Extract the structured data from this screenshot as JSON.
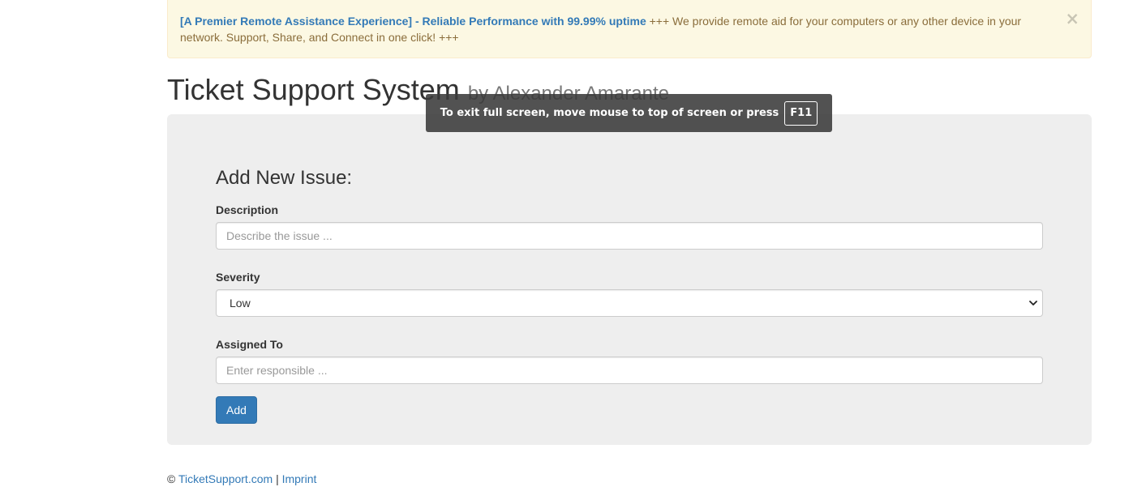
{
  "alert": {
    "link_text": "[A Premier Remote Assistance Experience] - Reliable Performance with 99.99% uptime",
    "message": " +++ We provide remote aid for your computers or any other device in your network. Support, Share, and Connect in one click! +++",
    "close_symbol": "×"
  },
  "header": {
    "title": "Ticket Support System",
    "subtitle": "by Alexander Amarante"
  },
  "form": {
    "title": "Add New Issue:",
    "description": {
      "label": "Description",
      "placeholder": "Describe the issue ..."
    },
    "severity": {
      "label": "Severity",
      "selected": "Low"
    },
    "assigned_to": {
      "label": "Assigned To",
      "placeholder": "Enter responsible ..."
    },
    "add_label": "Add"
  },
  "footer": {
    "copyright_symbol": "©",
    "site_link": "TicketSupport.com",
    "separator": "|",
    "imprint_link": "Imprint"
  },
  "fullscreen_toast": {
    "message": "To exit full screen, move mouse to top of screen or press",
    "key": "F11"
  },
  "colors": {
    "primary": "#337ab7",
    "alert_bg": "#fcf8e3",
    "alert_text": "#8a6d3b",
    "panel_bg": "#eeeeee"
  }
}
